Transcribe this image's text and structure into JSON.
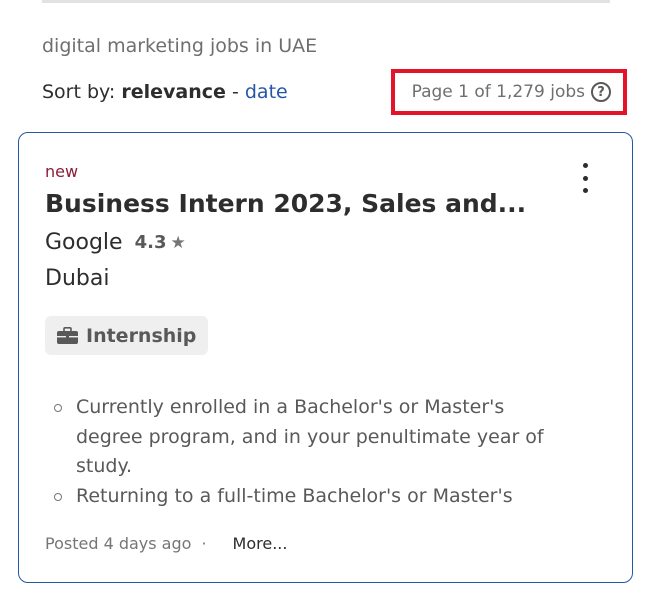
{
  "search": {
    "query_text": "digital marketing jobs in UAE"
  },
  "sort": {
    "prefix": "Sort by:",
    "active": "relevance",
    "separator": "-",
    "alternative": "date"
  },
  "pagination": {
    "text": "Page 1 of 1,279 jobs",
    "help_glyph": "?"
  },
  "job": {
    "new_label": "new",
    "title": "Business Intern 2023, Sales and...",
    "company": "Google",
    "rating": "4.3",
    "location": "Dubai",
    "job_type": "Internship",
    "snippet": [
      "Currently enrolled in a Bachelor's or Master's degree program, and in your penultimate year of study.",
      "Returning to a full-time Bachelor's or Master's"
    ],
    "posted": "Posted 4 days ago",
    "footer_sep": "·",
    "more_label": "More..."
  },
  "colors": {
    "link": "#2557a7",
    "highlight_border": "#e3142a",
    "new_label": "#8c1c3c",
    "card_border": "#2557a7"
  },
  "icons": [
    "help-icon",
    "kebab-menu-icon",
    "star-icon",
    "briefcase-icon",
    "bullet-icon"
  ]
}
